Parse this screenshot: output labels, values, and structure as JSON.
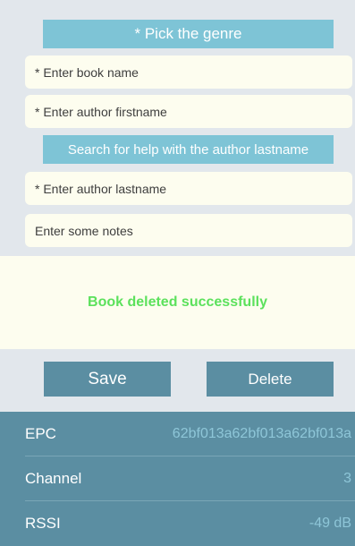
{
  "form": {
    "genre_button": "* Pick the genre",
    "book_name_placeholder": "* Enter book name",
    "author_firstname_placeholder": "* Enter author firstname",
    "author_help_button": "Search for help with the author lastname",
    "author_lastname_placeholder": "* Enter author lastname",
    "notes_placeholder": "Enter some notes"
  },
  "status": {
    "message": "Book deleted successfully",
    "color": "#5ce15c"
  },
  "actions": {
    "save_label": "Save",
    "delete_label": "Delete"
  },
  "tag_info": [
    {
      "label": "EPC",
      "value": "62bf013a62bf013a62bf013a"
    },
    {
      "label": "Channel",
      "value": "3"
    },
    {
      "label": "RSSI",
      "value": "-49 dB"
    }
  ],
  "colors": {
    "accent": "#7ec4d6",
    "panel": "#5b8ea2",
    "field_bg": "#fdfdef",
    "page_bg": "#e2e7ec"
  }
}
